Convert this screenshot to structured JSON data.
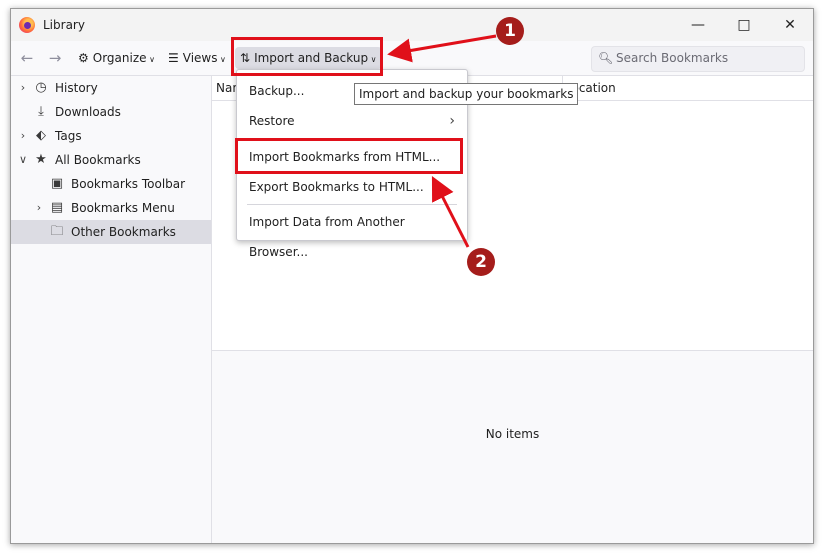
{
  "window": {
    "title": "Library"
  },
  "toolbar": {
    "organize_label": "Organize",
    "views_label": "Views",
    "import_backup_label": "Import and Backup",
    "search_placeholder": "Search Bookmarks"
  },
  "sidebar": {
    "items": [
      {
        "label": "History",
        "icon": "clock-icon"
      },
      {
        "label": "Downloads",
        "icon": "download-icon"
      },
      {
        "label": "Tags",
        "icon": "tag-icon"
      },
      {
        "label": "All Bookmarks",
        "icon": "star-icon"
      },
      {
        "label": "Bookmarks Toolbar",
        "icon": "bookmark-toolbar-icon"
      },
      {
        "label": "Bookmarks Menu",
        "icon": "bookmark-menu-icon"
      },
      {
        "label": "Other Bookmarks",
        "icon": "folder-icon"
      }
    ]
  },
  "columns": {
    "name": "Name",
    "location": "Location"
  },
  "details": {
    "empty_text": "No items"
  },
  "menu": {
    "items": [
      {
        "label": "Backup..."
      },
      {
        "label": "Restore"
      },
      {
        "label": "Import Bookmarks from HTML..."
      },
      {
        "label": "Export Bookmarks to HTML..."
      },
      {
        "label": "Import Data from Another Browser..."
      }
    ]
  },
  "tooltip": {
    "text": "Import and backup your bookmarks"
  },
  "annotations": {
    "step1": "1",
    "step2": "2",
    "color": "#e0101a",
    "badge_color": "#a51d1b"
  }
}
